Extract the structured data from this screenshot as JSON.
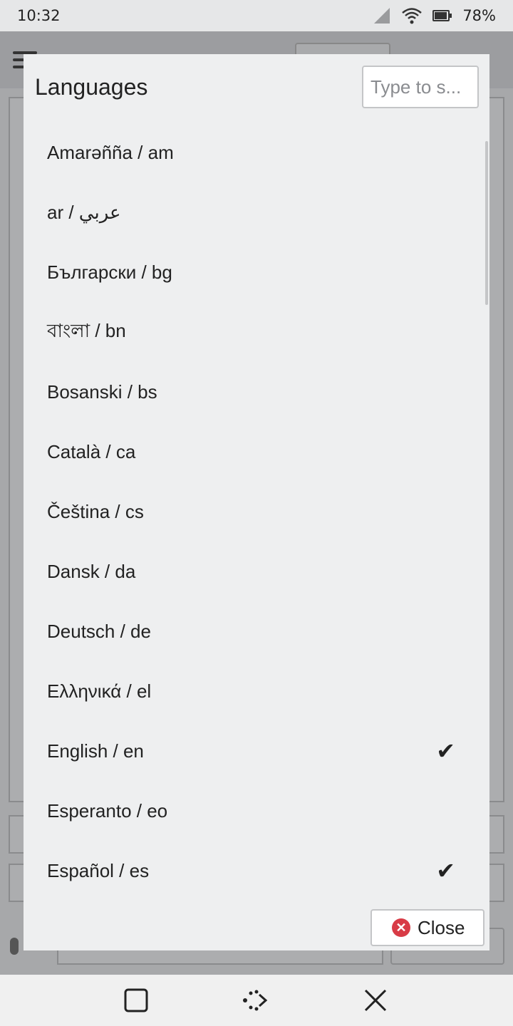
{
  "status_bar": {
    "time": "10:32",
    "battery_percent": "78%",
    "icons": [
      "cellular-signal-icon",
      "wifi-icon",
      "battery-icon"
    ]
  },
  "dialog": {
    "title": "Languages",
    "search_placeholder": "Type to s...",
    "close_label": "Close",
    "check_glyph": "✔",
    "languages": [
      {
        "label": "Amarəñña / am",
        "selected": false
      },
      {
        "label": "ar / عربي",
        "selected": false
      },
      {
        "label": "Български / bg",
        "selected": false
      },
      {
        "label": "বাংলা / bn",
        "selected": false
      },
      {
        "label": "Bosanski / bs",
        "selected": false
      },
      {
        "label": "Català / ca",
        "selected": false
      },
      {
        "label": "Čeština / cs",
        "selected": false
      },
      {
        "label": "Dansk / da",
        "selected": false
      },
      {
        "label": "Deutsch / de",
        "selected": false
      },
      {
        "label": "Ελληνικά / el",
        "selected": false
      },
      {
        "label": "English / en",
        "selected": true
      },
      {
        "label": "Esperanto / eo",
        "selected": false
      },
      {
        "label": "Español / es",
        "selected": true
      }
    ]
  },
  "nav_bar": {
    "icons": [
      "overview-square-icon",
      "keyboard-toggle-icon",
      "close-x-icon"
    ]
  },
  "colors": {
    "close_icon_red": "#d83b46",
    "dialog_bg": "#eeeff0",
    "scrim": "#a7a8aa"
  }
}
